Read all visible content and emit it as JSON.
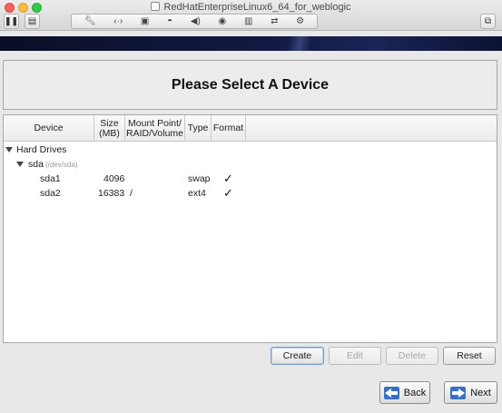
{
  "window": {
    "title": "RedHatEnterpriseLinux6_64_for_weblogic",
    "toolbar_icons": [
      "pause-icon",
      "snapshot-icon",
      "wrench-icon",
      "network-icon",
      "floppy-icon",
      "disk-icon",
      "sound-icon",
      "camera-icon",
      "printer-icon",
      "usb-icon",
      "settings-icon",
      "fullscreen-icon"
    ]
  },
  "page": {
    "heading": "Please Select A Device"
  },
  "tree": {
    "columns": {
      "device": "Device",
      "size_line1": "Size",
      "size_line2": "(MB)",
      "mount_line1": "Mount Point/",
      "mount_line2": "RAID/Volume",
      "type": "Type",
      "format": "Format"
    },
    "group": "Hard Drives",
    "disk": {
      "name": "sda",
      "path": "(/dev/sda)"
    },
    "partitions": [
      {
        "device": "sda1",
        "size": "4096",
        "mount": "",
        "type": "swap",
        "format": "✓"
      },
      {
        "device": "sda2",
        "size": "16383",
        "mount": "/",
        "type": "ext4",
        "format": "✓"
      }
    ]
  },
  "actions": {
    "create": "Create",
    "edit": "Edit",
    "delete": "Delete",
    "reset": "Reset"
  },
  "nav": {
    "back": "Back",
    "next": "Next"
  }
}
